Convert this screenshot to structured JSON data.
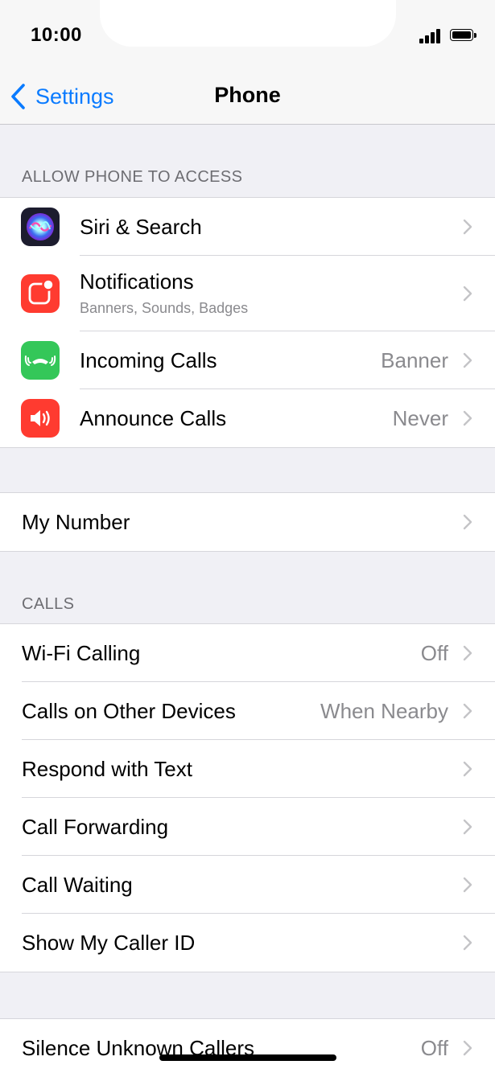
{
  "status_bar": {
    "time": "10:00"
  },
  "nav": {
    "back_label": "Settings",
    "title": "Phone"
  },
  "section_access": {
    "header": "ALLOW PHONE TO ACCESS",
    "items": [
      {
        "label": "Siri & Search",
        "icon": "siri-icon"
      },
      {
        "label": "Notifications",
        "subtitle": "Banners, Sounds, Badges",
        "icon": "notifications-icon",
        "color": "#ff3b30"
      },
      {
        "label": "Incoming Calls",
        "value": "Banner",
        "icon": "phone-icon",
        "color": "#34c759"
      },
      {
        "label": "Announce Calls",
        "value": "Never",
        "icon": "speaker-icon",
        "color": "#ff3b30"
      }
    ]
  },
  "my_number": {
    "label": "My Number"
  },
  "section_calls": {
    "header": "CALLS",
    "items": [
      {
        "label": "Wi-Fi Calling",
        "value": "Off"
      },
      {
        "label": "Calls on Other Devices",
        "value": "When Nearby"
      },
      {
        "label": "Respond with Text"
      },
      {
        "label": "Call Forwarding"
      },
      {
        "label": "Call Waiting"
      },
      {
        "label": "Show My Caller ID"
      }
    ]
  },
  "silence": {
    "label": "Silence Unknown Callers",
    "value": "Off"
  },
  "colors": {
    "accent": "#0a7bff",
    "background": "#f0f0f5"
  }
}
